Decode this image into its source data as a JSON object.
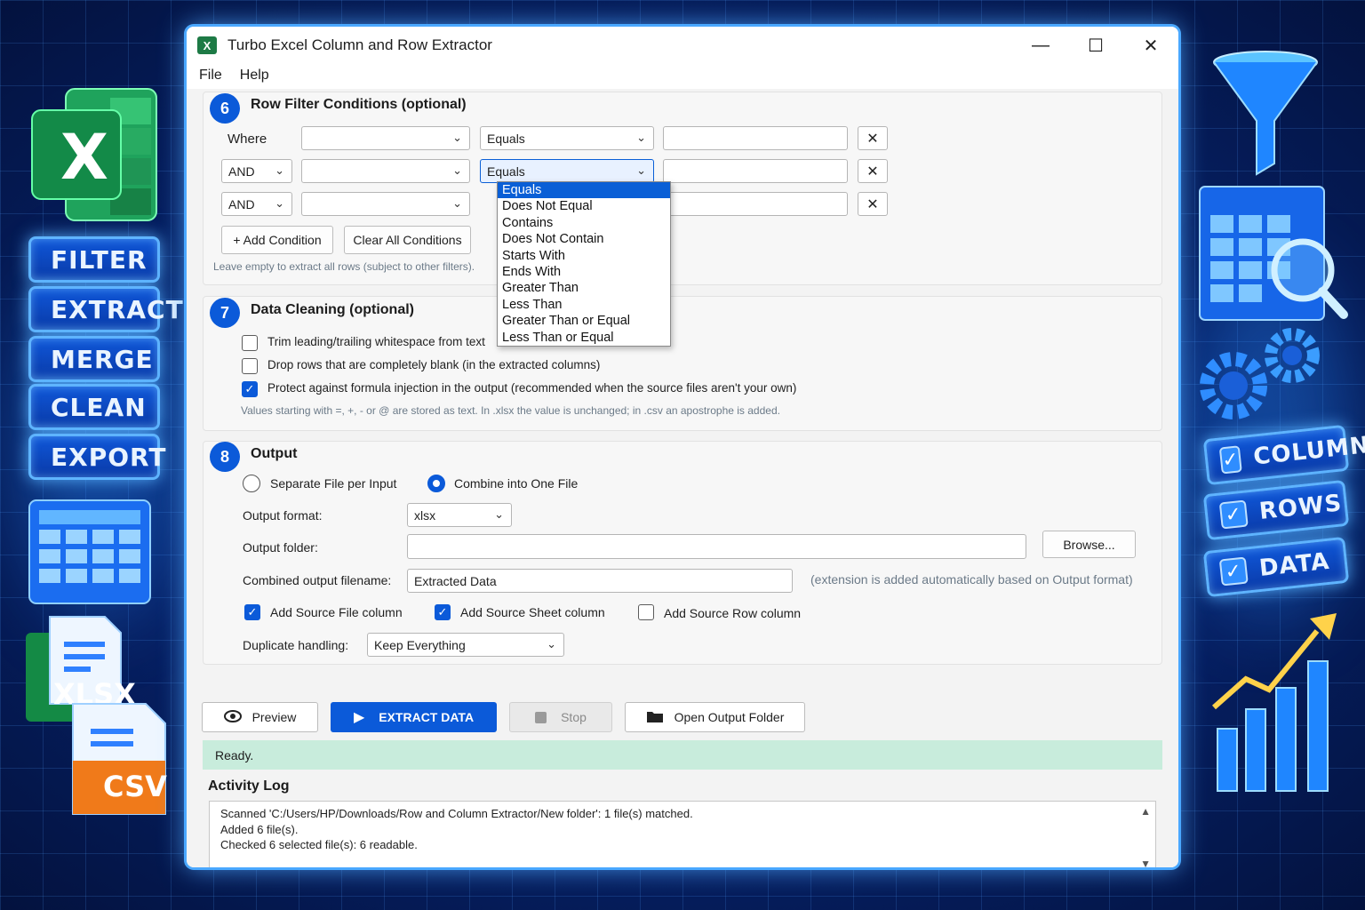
{
  "window": {
    "title": "Turbo Excel Column and Row Extractor",
    "icon_label": "X",
    "minimize": "—",
    "maximize": "☐",
    "close": "✕"
  },
  "menu": [
    "File",
    "Help"
  ],
  "background": {
    "left_labels": [
      "FILTER",
      "EXTRACT",
      "MERGE",
      "CLEAN",
      "EXPORT"
    ],
    "right_labels": [
      "COLUMNS",
      "ROWS",
      "DATA"
    ],
    "file_badges": [
      "XLSX",
      "CSV"
    ],
    "excel_letter": "X"
  },
  "filter": {
    "number": "6",
    "title": "Row Filter Conditions (optional)",
    "rows": [
      {
        "prefix": "Where",
        "column": "",
        "operator": "Equals",
        "value": ""
      },
      {
        "prefix": "AND",
        "column": "",
        "operator": "Equals",
        "value": ""
      },
      {
        "prefix": "AND",
        "column": "",
        "operator": "",
        "value": ""
      }
    ],
    "add_condition": "+ Add Condition",
    "clear_all": "Clear All Conditions",
    "hint": "Leave empty to extract all rows (subject to other filters).",
    "dropdown_options": [
      "Equals",
      "Does Not Equal",
      "Contains",
      "Does Not Contain",
      "Starts With",
      "Ends With",
      "Greater Than",
      "Less Than",
      "Greater Than or Equal",
      "Less Than or Equal"
    ],
    "dropdown_selected": "Equals"
  },
  "cleaning": {
    "number": "7",
    "title": "Data Cleaning (optional)",
    "options": [
      {
        "label": "Trim leading/trailing whitespace from text",
        "checked": false
      },
      {
        "label": "Drop rows that are completely blank (in the extracted columns)",
        "checked": false
      },
      {
        "label": "Protect against formula injection in the output (recommended when the source files aren't your own)",
        "checked": true
      }
    ],
    "hint": "Values starting with =, +, - or @ are stored as text. In .xlsx the value is unchanged; in .csv an apostrophe is added."
  },
  "output": {
    "number": "8",
    "title": "Output",
    "mode_separate": "Separate File per Input",
    "mode_combine": "Combine into One File",
    "format_label": "Output format:",
    "format_value": "xlsx",
    "folder_label": "Output folder:",
    "folder_value": "",
    "browse": "Browse...",
    "filename_label": "Combined output filename:",
    "filename_value": "Extracted Data",
    "filename_hint": "(extension is added automatically based on Output format)",
    "add_source_file": "Add Source File column",
    "add_source_sheet": "Add Source Sheet column",
    "add_source_row": "Add Source Row column",
    "duplicate_label": "Duplicate handling:",
    "duplicate_value": "Keep Everything"
  },
  "actions": {
    "preview": "Preview",
    "extract": "EXTRACT DATA",
    "stop": "Stop",
    "open_folder": "Open Output Folder"
  },
  "status": "Ready.",
  "log": {
    "title": "Activity Log",
    "lines": [
      "Scanned 'C:/Users/HP/Downloads/Row and Column Extractor/New folder': 1 file(s) matched.",
      "Added 6 file(s).",
      "Checked 6 selected file(s): 6 readable."
    ]
  }
}
